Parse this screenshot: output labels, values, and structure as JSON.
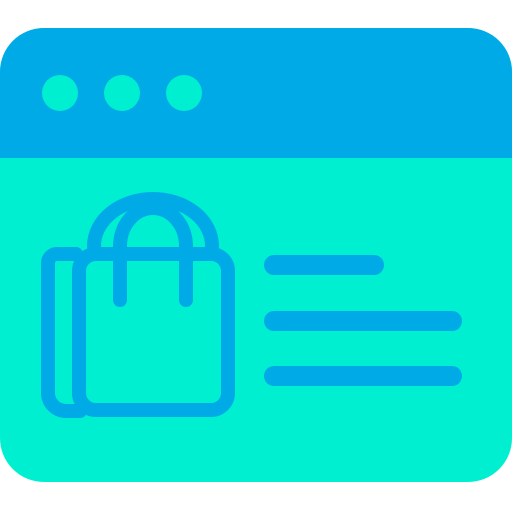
{
  "icon": {
    "name": "online-shopping-browser-icon",
    "colors": {
      "frame_header": "#00AAE7",
      "frame_body": "#00EFD1",
      "line_art": "#00AAE7",
      "window_dots": "#00EFD1"
    },
    "parts": {
      "window_dots": [
        "dot-1",
        "dot-2",
        "dot-3"
      ],
      "content_text_lines": [
        "short-line",
        "long-line-1",
        "long-line-2"
      ],
      "product_symbol": "shopping-bag-icon"
    }
  }
}
